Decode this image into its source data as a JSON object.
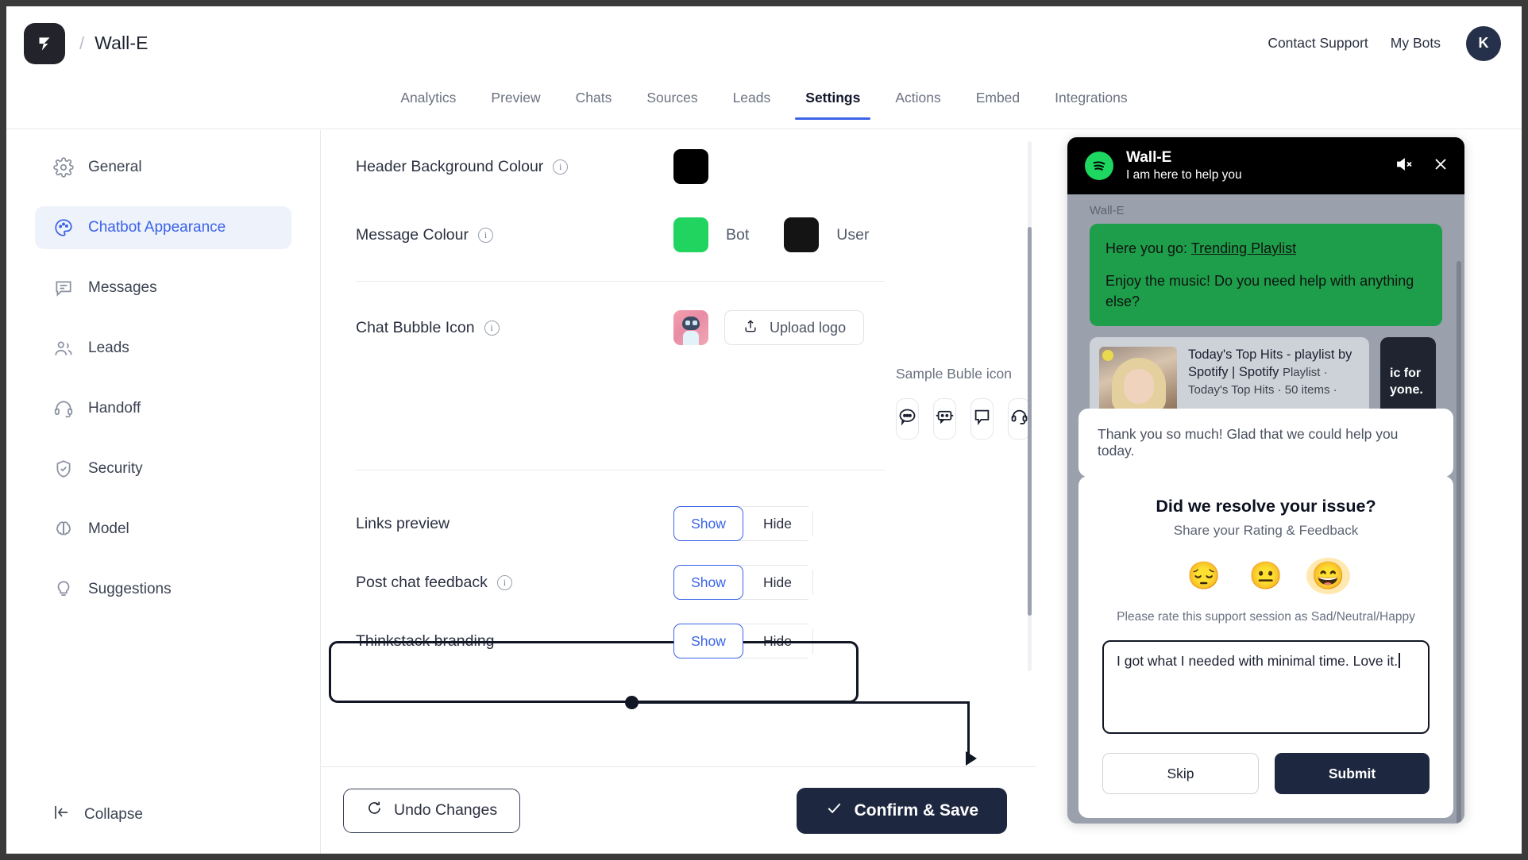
{
  "header": {
    "logo_icon": "thinkstack-logo-icon",
    "separator": "/",
    "bot_name": "Wall-E",
    "links": [
      {
        "label": "Contact Support",
        "name": "contact-support-link"
      },
      {
        "label": "My Bots",
        "name": "my-bots-link"
      }
    ],
    "avatar_initial": "K"
  },
  "nav": {
    "tabs": [
      {
        "label": "Analytics",
        "active": false
      },
      {
        "label": "Preview",
        "active": false
      },
      {
        "label": "Chats",
        "active": false
      },
      {
        "label": "Sources",
        "active": false
      },
      {
        "label": "Leads",
        "active": false
      },
      {
        "label": "Settings",
        "active": true
      },
      {
        "label": "Actions",
        "active": false
      },
      {
        "label": "Embed",
        "active": false
      },
      {
        "label": "Integrations",
        "active": false
      }
    ],
    "active_accent": "#3b63e8"
  },
  "sidebar": {
    "items": [
      {
        "label": "General",
        "icon": "gear-icon",
        "active": false
      },
      {
        "label": "Chatbot Appearance",
        "icon": "palette-icon",
        "active": true
      },
      {
        "label": "Messages",
        "icon": "message-icon",
        "active": false
      },
      {
        "label": "Leads",
        "icon": "users-icon",
        "active": false
      },
      {
        "label": "Handoff",
        "icon": "headset-icon",
        "active": false
      },
      {
        "label": "Security",
        "icon": "shield-check-icon",
        "active": false
      },
      {
        "label": "Model",
        "icon": "brain-icon",
        "active": false
      },
      {
        "label": "Suggestions",
        "icon": "lightbulb-icon",
        "active": false
      }
    ],
    "collapse_label": "Collapse",
    "collapse_icon": "collapse-panel-icon"
  },
  "settings": {
    "header_background": {
      "label": "Header Background Colour",
      "info_icon": "info-icon",
      "value": "#000000"
    },
    "message_colour": {
      "label": "Message Colour",
      "info_icon": "info-icon",
      "bot": {
        "label": "Bot",
        "value": "#21d45f"
      },
      "user": {
        "label": "User",
        "value": "#141414"
      }
    },
    "chat_bubble_icon": {
      "label": "Chat Bubble Icon",
      "info_icon": "info-icon",
      "upload_label": "Upload logo",
      "upload_icon": "upload-icon",
      "avatar_name": "bot-avatar-preview",
      "sample_caption": "Sample Buble icon",
      "options": [
        {
          "name": "chat-dots-icon"
        },
        {
          "name": "robot-chat-icon"
        },
        {
          "name": "speech-bubble-icon"
        },
        {
          "name": "headset-bubble-icon"
        },
        {
          "name": "info-circle-icon"
        }
      ]
    },
    "toggles": [
      {
        "label": "Links preview",
        "has_info": false,
        "show_label": "Show",
        "hide_label": "Hide",
        "selected": "Show",
        "highlighted": false
      },
      {
        "label": "Post chat feedback",
        "has_info": true,
        "show_label": "Show",
        "hide_label": "Hide",
        "selected": "Show",
        "highlighted": true
      },
      {
        "label": "Thinkstack branding",
        "has_info": false,
        "show_label": "Show",
        "hide_label": "Hide",
        "selected": "Show",
        "highlighted": false
      }
    ],
    "footer": {
      "undo_label": "Undo Changes",
      "undo_icon": "refresh-ccw-icon",
      "save_label": "Confirm & Save",
      "save_icon": "check-icon",
      "save_bg": "#1d2840"
    }
  },
  "widget": {
    "header": {
      "logo_icon": "spotify-icon",
      "title": "Wall-E",
      "subtitle": "I am here to help you",
      "mute_icon": "mute-icon",
      "close_icon": "close-icon",
      "bg": "#000000"
    },
    "sender_name": "Wall-E",
    "bot_message": {
      "line1_prefix": "Here you go: ",
      "link_text": "Trending Playlist",
      "line2": "Enjoy the music! Do you need help with anything else?",
      "bg": "#1e9e4a"
    },
    "link_cards": [
      {
        "title": "Today's Top Hits - playlist by Spotify | Spotify",
        "meta": "Playlist · Today's Top Hits · 50 items ·",
        "thumb_name": "playlist-thumbnail"
      },
      {
        "title": "ic for yone.",
        "thumb_name": "partial-card"
      }
    ],
    "thanks_message": "Thank you so much! Glad that we could help you today.",
    "feedback": {
      "title": "Did we resolve your issue?",
      "subtitle": "Share your Rating & Feedback",
      "emojis": [
        {
          "glyph": "😔",
          "name": "sad-emoji",
          "selected": false
        },
        {
          "glyph": "😐",
          "name": "neutral-emoji",
          "selected": false
        },
        {
          "glyph": "😄",
          "name": "happy-emoji",
          "selected": true
        }
      ],
      "rate_hint": "Please rate this support session as Sad/Neutral/Happy",
      "textarea_value": "I got what I needed with minimal time. Love it.",
      "skip_label": "Skip",
      "submit_label": "Submit",
      "submit_bg": "#1d2840"
    }
  }
}
